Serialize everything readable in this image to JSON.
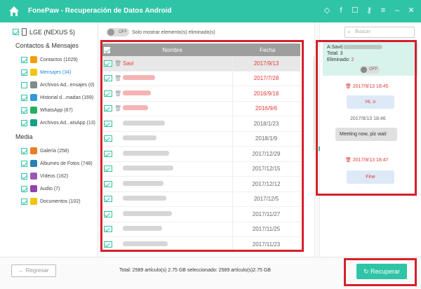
{
  "app": {
    "title": "FonePaw - Recuperación de Datos Android",
    "title_icons": [
      "diamond-icon",
      "facebook-icon",
      "chat-icon",
      "key-icon",
      "menu-icon",
      "minimize-icon",
      "close-icon"
    ]
  },
  "sidebar": {
    "device": "LGE (NEXUS 5)",
    "sections": [
      {
        "label": "Contactos & Mensajes",
        "items": [
          {
            "label": "Contactos (1029)",
            "color": "#f39c12",
            "active": false
          },
          {
            "label": "Mensajes (34)",
            "color": "#f1c40f",
            "active": true
          },
          {
            "label": "Archivos Ad...ensajes (0)",
            "color": "#7f8c8d",
            "active": false
          },
          {
            "label": "Historial d...madas (169)",
            "color": "#3498db",
            "active": false
          },
          {
            "label": "WhatsApp (67)",
            "color": "#27ae60",
            "active": false
          },
          {
            "label": "Archivos Ad...atsApp (13)",
            "color": "#16a085",
            "active": false
          }
        ]
      },
      {
        "label": "Media",
        "items": [
          {
            "label": "Galería (258)",
            "color": "#e67e22",
            "active": false
          },
          {
            "label": "Álbumes de Fotos (748)",
            "color": "#2980b9",
            "active": false
          },
          {
            "label": "Vídeos (162)",
            "color": "#9b59b6",
            "active": false
          },
          {
            "label": "Audio (7)",
            "color": "#8e44ad",
            "active": false
          },
          {
            "label": "Documentos (102)",
            "color": "#f1c40f",
            "active": false
          }
        ]
      }
    ]
  },
  "main": {
    "toggle_state": "OFF",
    "toggle_label": "Solo mostrar elemento(s) eliminado(s)",
    "columns": {
      "name": "Nombre",
      "date": "Fecha"
    },
    "rows": [
      {
        "name": "Savi",
        "date": "2017/9/13",
        "deleted": true,
        "selected": true
      },
      {
        "name": "",
        "date": "2017/7/28",
        "deleted": true
      },
      {
        "name": "",
        "date": "2016/9/18",
        "deleted": true
      },
      {
        "name": "",
        "date": "2016/9/6",
        "deleted": true
      },
      {
        "name": "",
        "date": "2018/1/23",
        "deleted": false
      },
      {
        "name": "",
        "date": "2018/1/9",
        "deleted": false
      },
      {
        "name": "",
        "date": "2017/12/29",
        "deleted": false
      },
      {
        "name": "",
        "date": "2017/12/15",
        "deleted": false
      },
      {
        "name": "",
        "date": "2017/12/12",
        "deleted": false
      },
      {
        "name": "",
        "date": "2017/12/5",
        "deleted": false
      },
      {
        "name": "",
        "date": "2017/11/27",
        "deleted": false
      },
      {
        "name": "",
        "date": "2017/11/25",
        "deleted": false
      },
      {
        "name": "",
        "date": "2017/11/23",
        "deleted": false
      }
    ]
  },
  "preview": {
    "search_placeholder": "Buscar",
    "to": "A:Savi(",
    "total": "Total: 3",
    "deleted_label": "Eliminado:",
    "deleted_count": "2",
    "toggle_state": "OFF",
    "messages": [
      {
        "time": "2017/9/13 18:45",
        "deleted": true
      },
      {
        "text": "Hi, o",
        "direction": "out"
      },
      {
        "time": "2017/9/13 18:46",
        "deleted": false
      },
      {
        "text": "Meeting now, plz wait",
        "direction": "in"
      },
      {
        "time": "2017/9/13 18:47",
        "deleted": true
      },
      {
        "text": "Fine",
        "direction": "out"
      }
    ]
  },
  "footer": {
    "back": "Regresar",
    "summary": "Total: 2589 artículo(s) 2.75 GB seleccionado: 2589 artículo(s)2.75 GB",
    "recover": "Recuperar"
  }
}
